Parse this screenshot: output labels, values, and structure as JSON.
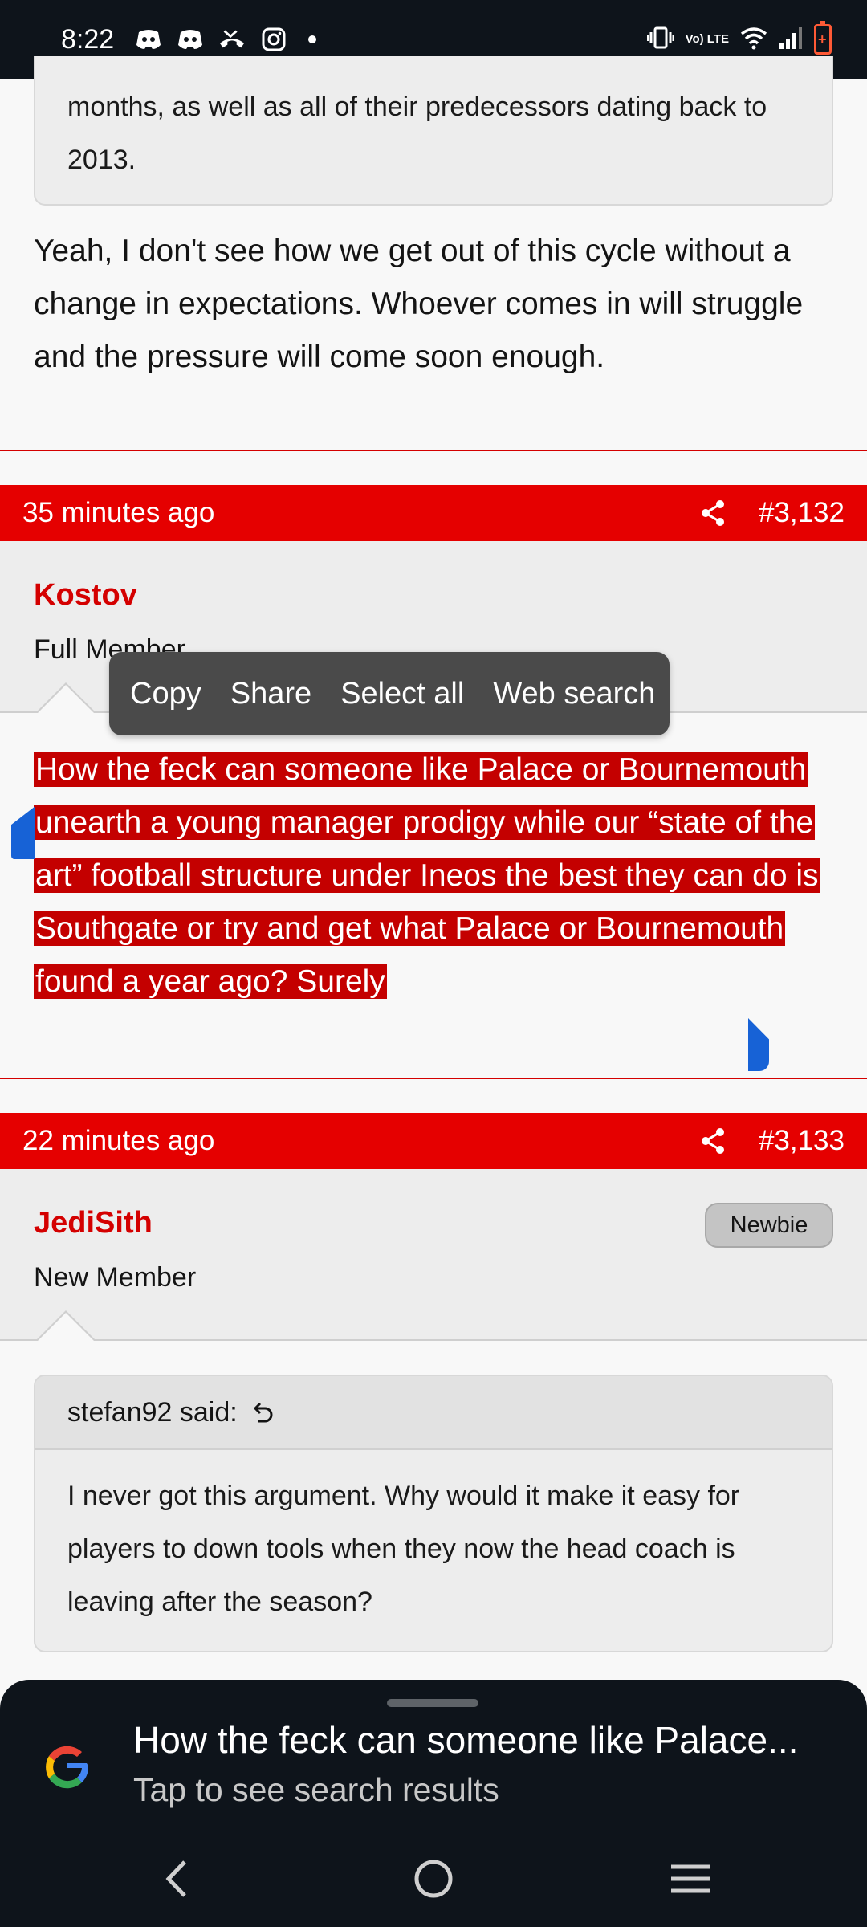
{
  "status_bar": {
    "time": "8:22",
    "lte_label": "Vo) LTE",
    "icons": [
      "discord-icon",
      "discord-icon",
      "missed-call-icon",
      "instagram-icon",
      "dot-icon",
      "vibrate-icon",
      "lte-icon",
      "wifi-icon",
      "signal-icon",
      "battery-charging-icon"
    ],
    "battery_color": "#ff5a36"
  },
  "top_quote": {
    "text": "months, as well as all of their predecessors dating back to 2013."
  },
  "post_3131": {
    "body": "Yeah, I don't see how we get out of this cycle without a change in expectations. Whoever comes in will struggle and the pressure will come soon enough."
  },
  "post_3132": {
    "time": "35 minutes ago",
    "number": "#3,132",
    "username": "Kostov",
    "user_title": "Full Member",
    "body": "How the feck can someone like Palace or Bournemouth unearth a young manager prodigy while our “state of the art” football structure under Ineos the best they can do is Southgate or try and get what Palace or Bournemouth found a year ago? Surely"
  },
  "context_menu": {
    "items": [
      "Copy",
      "Share",
      "Select all",
      "Web search"
    ]
  },
  "post_3133": {
    "time": "22 minutes ago",
    "number": "#3,133",
    "username": "JediSith",
    "user_title": "New Member",
    "badge": "Newbie",
    "quote_author": "stefan92 said:",
    "quote_text": "I never got this argument. Why would it make it easy for players to down tools when they now the head coach is leaving after the season?"
  },
  "search_sheet": {
    "title": "How the feck can someone like Palace...",
    "subtitle": "Tap to see search results"
  },
  "colors": {
    "accent_red": "#e50000",
    "selection": "#c40000",
    "handle_blue": "#1762d6"
  }
}
